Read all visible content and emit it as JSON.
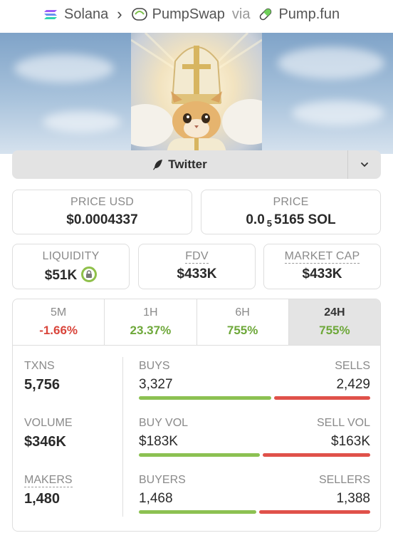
{
  "breadcrumb": {
    "chain": "Solana",
    "dex": "PumpSwap",
    "via_text": "via",
    "launchpad": "Pump.fun"
  },
  "social": {
    "twitter_label": "Twitter"
  },
  "price": {
    "usd_label": "PRICE USD",
    "usd_value": "$0.0004337",
    "native_label": "PRICE",
    "native_prefix": "0.0",
    "native_subscript": "5",
    "native_rest": "5165 SOL"
  },
  "stats": {
    "liquidity_label": "LIQUIDITY",
    "liquidity_value": "$51K",
    "fdv_label": "FDV",
    "fdv_value": "$433K",
    "mcap_label": "MARKET CAP",
    "mcap_value": "$433K"
  },
  "timeframes": [
    {
      "label": "5M",
      "value": "-1.66%",
      "trend": "neg",
      "active": false
    },
    {
      "label": "1H",
      "value": "23.37%",
      "trend": "pos",
      "active": false
    },
    {
      "label": "6H",
      "value": "755%",
      "trend": "pos",
      "active": false
    },
    {
      "label": "24H",
      "value": "755%",
      "trend": "pos",
      "active": true
    }
  ],
  "metrics": {
    "txns_label": "TXNS",
    "txns_value": "5,756",
    "volume_label": "VOLUME",
    "volume_value": "$346K",
    "makers_label": "MAKERS",
    "makers_value": "1,480",
    "buys_label": "BUYS",
    "buys_value": "3,327",
    "sells_label": "SELLS",
    "sells_value": "2,429",
    "buyvol_label": "BUY VOL",
    "buyvol_value": "$183K",
    "sellvol_label": "SELL VOL",
    "sellvol_value": "$163K",
    "buyers_label": "BUYERS",
    "buyers_value": "1,468",
    "sellers_label": "SELLERS",
    "sellers_value": "1,388"
  },
  "ratios": {
    "buys_share": 0.578,
    "buyvol_share": 0.529,
    "buyers_share": 0.514
  },
  "colors": {
    "positive": "#6ea83a",
    "negative": "#d9453b",
    "bar_buy": "#8cc152",
    "bar_sell": "#e0514a"
  },
  "icons": [
    "solana-icon",
    "pumpswap-icon",
    "pill-icon",
    "chevron-right-icon",
    "feather-icon",
    "chevron-down-icon",
    "lock-icon"
  ]
}
